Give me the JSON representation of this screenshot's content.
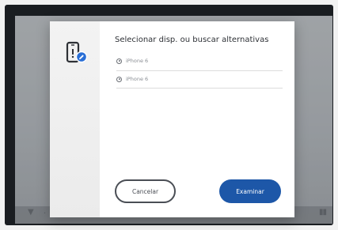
{
  "dialog": {
    "title": "Selecionar disp. ou buscar alternativas",
    "options": [
      {
        "label": "iPhone 6"
      },
      {
        "label": "iPhone 6"
      }
    ],
    "cancel_label": "Cancelar",
    "examine_label": "Examinar"
  },
  "colors": {
    "primary_button": "#1d57a8",
    "device_icon_badge": "#2a6fd6",
    "cancel_border": "#4a4e55"
  },
  "icons": {
    "device": "phone-with-badge-icon",
    "option": "radio-icon",
    "screen_left": "speaker-icon",
    "screen_right": "pause-icon"
  }
}
